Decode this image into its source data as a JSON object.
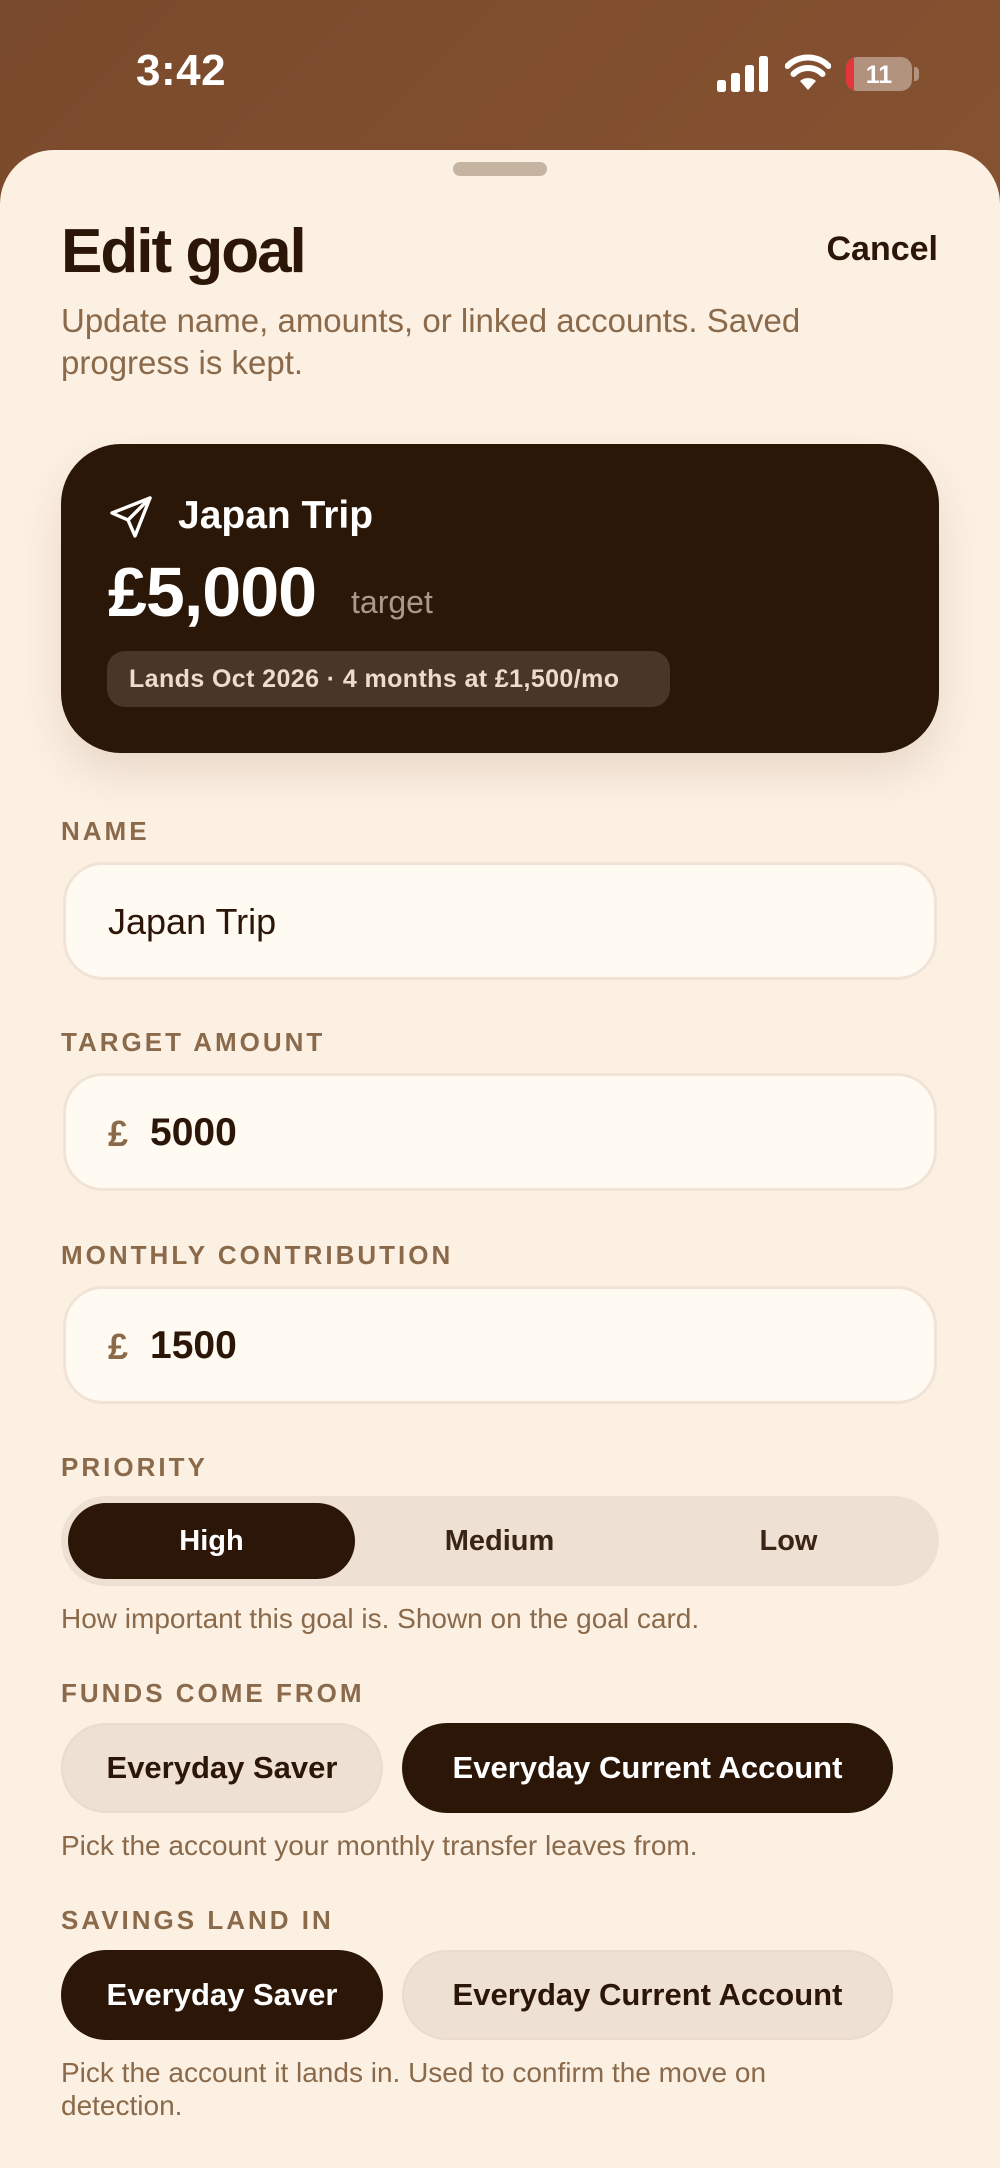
{
  "status": {
    "time": "3:42",
    "battery": "11"
  },
  "sheet": {
    "title": "Edit goal",
    "cancel_label": "Cancel",
    "subtitle": "Update name, amounts, or linked accounts. Saved progress is kept."
  },
  "hero": {
    "icon": "paper-plane-icon",
    "name": "Japan Trip",
    "amount": "£5,000",
    "amount_suffix": "target",
    "summary": "Lands Oct 2026 · 4 months at £1,500/mo"
  },
  "fields": {
    "name_label": "NAME",
    "name_value": "Japan Trip",
    "target_label": "TARGET AMOUNT",
    "target_currency": "£",
    "target_value": "5000",
    "monthly_label": "MONTHLY CONTRIBUTION",
    "monthly_currency": "£",
    "monthly_value": "1500"
  },
  "priority": {
    "label": "PRIORITY",
    "options": [
      "High",
      "Medium",
      "Low"
    ],
    "selected": "High",
    "help": "How important this goal is. Shown on the goal card."
  },
  "funds_from": {
    "label": "FUNDS COME FROM",
    "options": [
      "Everyday Saver",
      "Everyday Current Account"
    ],
    "selected": "Everyday Current Account",
    "help": "Pick the account your monthly transfer leaves from."
  },
  "savings_land": {
    "label": "SAVINGS LAND IN",
    "options": [
      "Everyday Saver",
      "Everyday Current Account"
    ],
    "selected": "Everyday Saver",
    "help": "Pick the account it lands in. Used to confirm the move on detection."
  },
  "colors": {
    "background": "#fcf0e3",
    "dark": "#2b1608",
    "muted": "#8a6a4a",
    "chip_inactive": "#eee1d4"
  }
}
